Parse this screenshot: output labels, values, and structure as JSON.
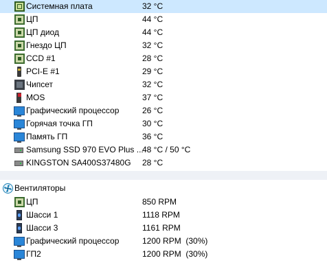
{
  "temperatures": [
    {
      "label": "Системная плата",
      "value": "32 °C",
      "icon": "motherboard-icon"
    },
    {
      "label": "ЦП",
      "value": "44 °C",
      "icon": "cpu-chip-icon"
    },
    {
      "label": "ЦП диод",
      "value": "44 °C",
      "icon": "cpu-chip-icon"
    },
    {
      "label": "Гнездо ЦП",
      "value": "32 °C",
      "icon": "cpu-chip-icon"
    },
    {
      "label": "CCD #1",
      "value": "28 °C",
      "icon": "cpu-chip-icon"
    },
    {
      "label": "PCI-E #1",
      "value": "29 °C",
      "icon": "pcie-slot-icon"
    },
    {
      "label": "Чипсет",
      "value": "32 °C",
      "icon": "chipset-icon"
    },
    {
      "label": "MOS",
      "value": "37 °C",
      "icon": "mos-icon"
    },
    {
      "label": "Графический процессор",
      "value": "26 °C",
      "icon": "monitor-icon"
    },
    {
      "label": "Горячая точка ГП",
      "value": "30 °C",
      "icon": "monitor-icon"
    },
    {
      "label": "Память ГП",
      "value": "36 °C",
      "icon": "monitor-icon"
    },
    {
      "label": "Samsung SSD 970 EVO Plus ...",
      "value": "48 °C / 50 °C",
      "icon": "disk-icon"
    },
    {
      "label": "KINGSTON SA400S37480G",
      "value": "28 °C",
      "icon": "disk-icon"
    }
  ],
  "fans": {
    "title": "Вентиляторы",
    "icon": "fan-icon",
    "items": [
      {
        "label": "ЦП",
        "value": "850 RPM",
        "icon": "cpu-chip-icon"
      },
      {
        "label": "Шасси 1",
        "value": "1118 RPM",
        "icon": "case-fan-icon"
      },
      {
        "label": "Шасси 3",
        "value": "1161 RPM",
        "icon": "case-fan-icon"
      },
      {
        "label": "Графический процессор",
        "value": "1200 RPM  (30%)",
        "icon": "monitor-icon"
      },
      {
        "label": "ГП2",
        "value": "1200 RPM  (30%)",
        "icon": "monitor-icon"
      }
    ]
  },
  "colors": {
    "selection": "#cde8ff",
    "separator": "#eef1f6"
  }
}
